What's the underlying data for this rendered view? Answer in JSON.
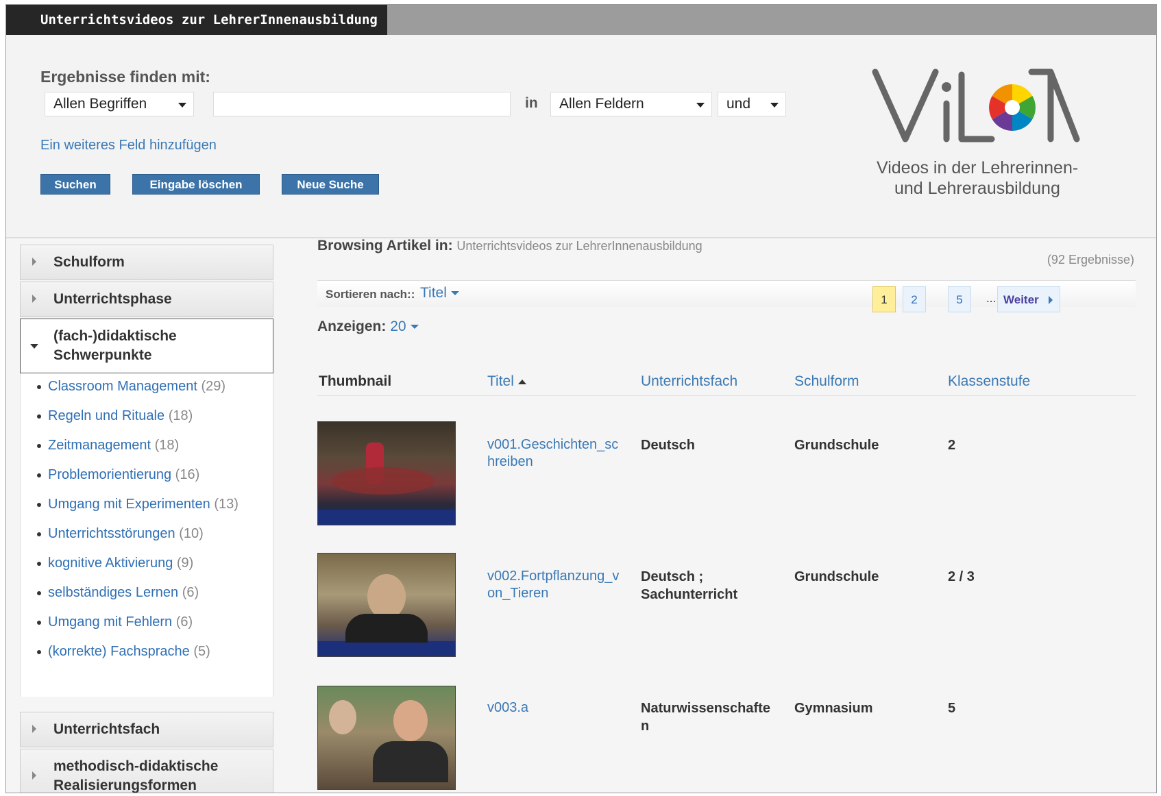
{
  "header": {
    "title": "Unterrichtsvideos zur LehrerInnenausbildung"
  },
  "search": {
    "find_label": "Ergebnisse finden mit:",
    "match_select": "Allen Begriffen",
    "query_value": "",
    "in_label": "in",
    "field_select": "Allen Feldern",
    "bool_select": "und",
    "add_field_link": "Ein weiteres Feld hinzufügen",
    "buttons": {
      "search": "Suchen",
      "clear": "Eingabe löschen",
      "new": "Neue Suche"
    }
  },
  "logo": {
    "wordmark": "ViLTA",
    "line1": "Videos in der Lehrerinnen-",
    "line2": "und Lehrerausbildung",
    "colors": [
      "#e4322b",
      "#f39200",
      "#ffd500",
      "#3fa535",
      "#0086c3",
      "#6b3a96"
    ]
  },
  "sidebar": {
    "facets": [
      {
        "label": "Schulform",
        "state": "collapsed"
      },
      {
        "label": "Unterrichtsphase",
        "state": "collapsed"
      },
      {
        "label": "(fach-)didaktische Schwerpunkte",
        "state": "open"
      },
      {
        "label": "Unterrichtsfach",
        "state": "collapsed"
      },
      {
        "label": "methodisch-didaktische Realisierungsformen",
        "state": "collapsed"
      }
    ],
    "items": [
      {
        "label": "Classroom Management",
        "count": "(29)"
      },
      {
        "label": "Regeln und Rituale",
        "count": "(18)"
      },
      {
        "label": "Zeitmanagement",
        "count": "(18)"
      },
      {
        "label": "Problemorientierung",
        "count": "(16)"
      },
      {
        "label": "Umgang mit Experimenten",
        "count": "(13)"
      },
      {
        "label": "Unterrichtsstörungen",
        "count": "(10)"
      },
      {
        "label": "kognitive Aktivierung",
        "count": "(9)"
      },
      {
        "label": "selbständiges Lernen",
        "count": "(6)"
      },
      {
        "label": "Umgang mit Fehlern",
        "count": "(6)"
      },
      {
        "label": "(korrekte) Fachsprache",
        "count": "(5)"
      }
    ]
  },
  "results": {
    "browsing_label": "Browsing Artikel in:",
    "browsing_value": "Unterrichtsvideos zur LehrerInnenausbildung",
    "count_text": "(92 Ergebnisse)",
    "sort_label": "Sortieren nach::",
    "sort_value": "Titel",
    "show_label": "Anzeigen:",
    "show_value": "20",
    "pagination": {
      "pages": [
        "1",
        "2",
        "5"
      ],
      "ellipsis": "...",
      "current": "1",
      "next": "Weiter"
    },
    "columns": [
      "Thumbnail",
      "Titel",
      "Unterrichtsfach",
      "Schulform",
      "Klassenstufe"
    ],
    "rows": [
      {
        "title": "v001.Geschichten_schreiben",
        "fach": "Deutsch",
        "schulform": "Grundschule",
        "stufe": "2"
      },
      {
        "title": "v002.Fortpflanzung_von_Tieren",
        "fach": "Deutsch ; Sachunterricht",
        "schulform": "Grundschule",
        "stufe": "2 / 3"
      },
      {
        "title": "v003.a",
        "fach": "Naturwissenschaften",
        "schulform": "Gymnasium",
        "stufe": "5"
      }
    ]
  }
}
